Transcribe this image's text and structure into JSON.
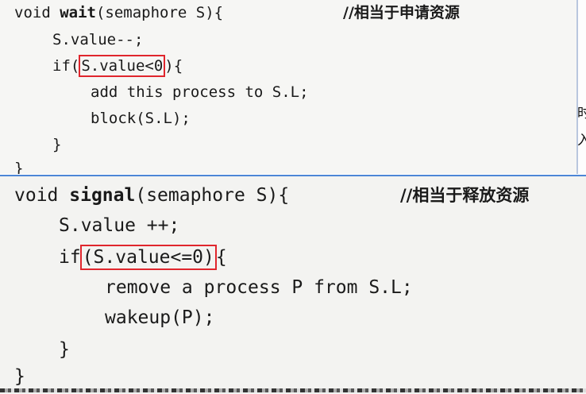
{
  "wait_block": {
    "signature_pre": "void ",
    "func_name": "wait",
    "signature_post": "(semaphore S){",
    "comment": "//相当于申请资源",
    "line_decrement": "S.value--;",
    "if_keyword": "if(",
    "condition": "S.value<0",
    "if_close": "){",
    "stmt_add": "add this process to S.L;",
    "stmt_block": "block(S.L);",
    "inner_close": "}",
    "outer_close": "}"
  },
  "signal_block": {
    "signature_pre": "void ",
    "func_name": "signal",
    "signature_post": "(semaphore S){",
    "comment": "//相当于释放资源",
    "line_increment": "S.value ++;",
    "if_keyword": "if",
    "condition": "(S.value<=0)",
    "if_close": "{",
    "stmt_remove": "remove a process P from S.L;",
    "stmt_wakeup": "wakeup(P);",
    "inner_close": "}",
    "outer_close": "}"
  },
  "side_fragment": {
    "char1": "时",
    "char2": "入"
  },
  "colors": {
    "highlight_box": "#e0262d",
    "divider": "#4d86d6"
  }
}
